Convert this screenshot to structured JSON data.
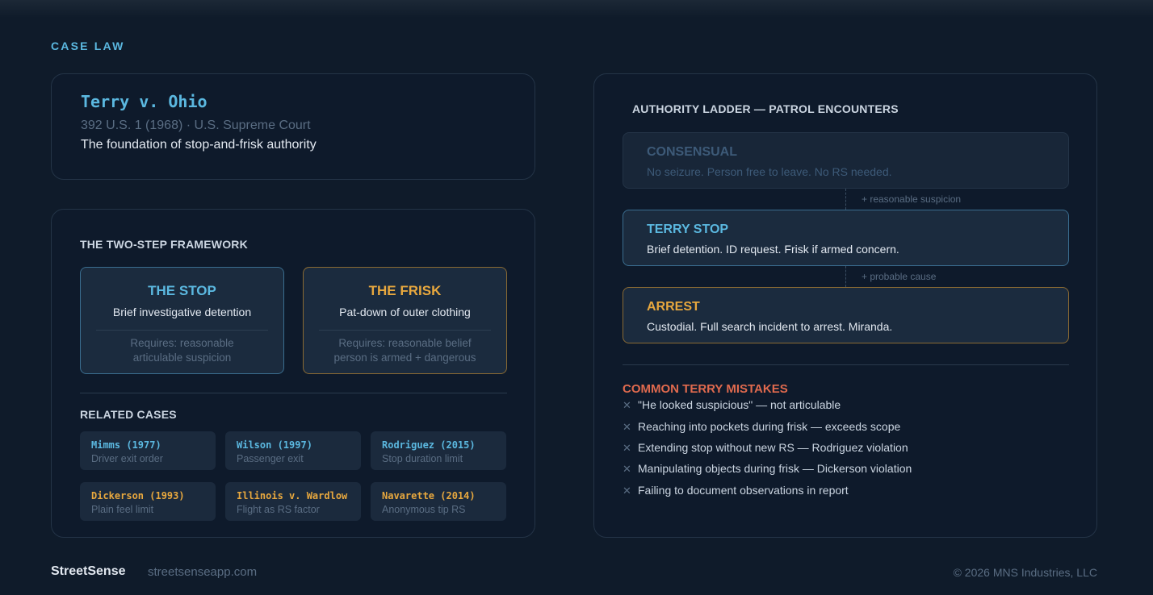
{
  "eyebrow": "CASE LAW",
  "hero": {
    "title": "Terry v. Ohio",
    "citation": "392 U.S. 1 (1968) · U.S. Supreme Court",
    "description": "The foundation of stop-and-frisk authority"
  },
  "framework": {
    "heading": "THE TWO-STEP FRAMEWORK",
    "stop": {
      "title": "THE STOP",
      "description": "Brief investigative detention",
      "requirement_line1": "Requires: reasonable",
      "requirement_line2": "articulable suspicion"
    },
    "frisk": {
      "title": "THE FRISK",
      "description": "Pat-down of outer clothing",
      "requirement_line1": "Requires: reasonable belief",
      "requirement_line2": "person is armed + dangerous"
    }
  },
  "related": {
    "heading": "RELATED CASES",
    "cases": [
      {
        "name": "Mimms (1977)",
        "subtitle": "Driver exit order"
      },
      {
        "name": "Wilson (1997)",
        "subtitle": "Passenger exit"
      },
      {
        "name": "Rodriguez (2015)",
        "subtitle": "Stop duration limit"
      },
      {
        "name": "Dickerson (1993)",
        "subtitle": "Plain feel limit"
      },
      {
        "name": "Illinois v. Wardlow",
        "subtitle": "Flight as RS factor"
      },
      {
        "name": "Navarette (2014)",
        "subtitle": "Anonymous tip RS"
      }
    ]
  },
  "ladder": {
    "heading": "AUTHORITY LADDER — PATROL ENCOUNTERS",
    "rungs": [
      {
        "title": "CONSENSUAL",
        "description": "No seizure. Person free to leave. No RS needed."
      },
      {
        "title": "TERRY STOP",
        "description": "Brief detention. ID request. Frisk if armed concern."
      },
      {
        "title": "ARREST",
        "description": "Custodial. Full search incident to arrest. Miranda."
      }
    ],
    "connectors": [
      "+ reasonable suspicion",
      "+ probable cause"
    ]
  },
  "mistakes": {
    "heading": "COMMON TERRY MISTAKES",
    "marker": "✕",
    "items": [
      "\"He looked suspicious\" — not articulable",
      "Reaching into pockets during frisk — exceeds scope",
      "Extending stop without new RS — Rodriguez violation",
      "Manipulating objects during frisk — Dickerson violation",
      "Failing to document observations in report"
    ]
  },
  "footer": {
    "brand": "StreetSense",
    "site": "streetsenseapp.com",
    "copyright": "© 2026 MNS Industries, LLC"
  },
  "colors": {
    "background": "#0f1b2a",
    "accent_blue": "#5bb8e0",
    "accent_amber": "#e8a83e",
    "accent_red": "#e06a4e"
  }
}
